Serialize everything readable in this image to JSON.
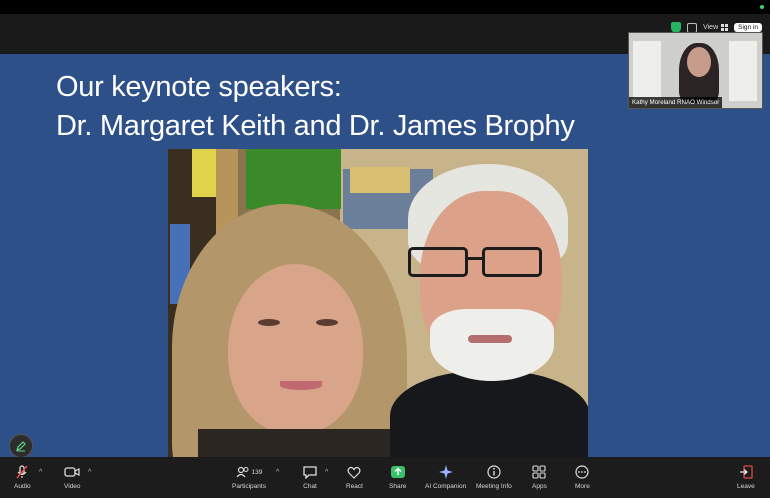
{
  "slide": {
    "title_line1": "Our keynote speakers:",
    "title_line2": "Dr. Margaret Keith and Dr. James Brophy"
  },
  "header": {
    "view_label": "View",
    "signin_label": "Sign in"
  },
  "self_view": {
    "name": "Kathy Moreland RNAO Windsor"
  },
  "toolbar": {
    "audio": "Audio",
    "video": "Video",
    "participants": "Participants",
    "participants_count": "139",
    "chat": "Chat",
    "react": "React",
    "share": "Share",
    "ai_companion": "AI Companion",
    "meeting_info": "Meeting Info",
    "apps": "Apps",
    "more": "More",
    "leave": "Leave"
  },
  "colors": {
    "slide_bg": "#2e5089",
    "share_green": "#3ac16a",
    "leave_red": "#e04848",
    "muted_red": "#e34a4a"
  }
}
